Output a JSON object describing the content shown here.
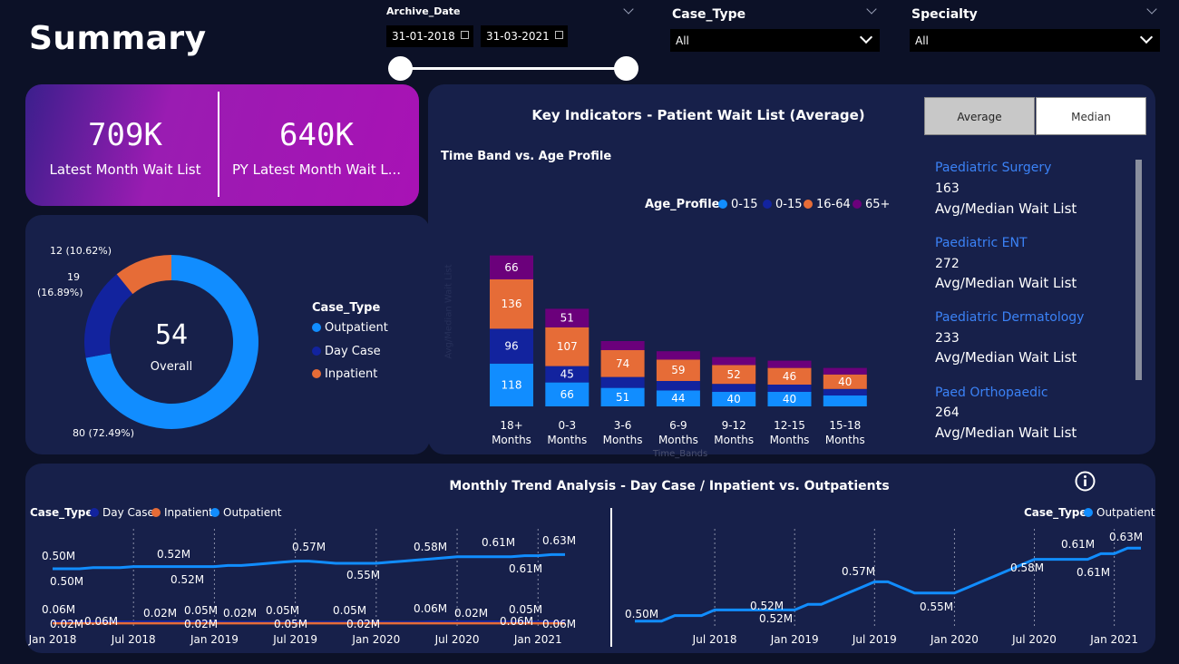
{
  "page_title": "Summary",
  "filters": {
    "archive_date": {
      "label": "Archive_Date",
      "start": "31-01-2018",
      "end": "31-03-2021"
    },
    "case_type": {
      "label": "Case_Type",
      "value": "All"
    },
    "specialty": {
      "label": "Specialty",
      "value": "All"
    }
  },
  "kpis": [
    {
      "value": "709K",
      "label": "Latest Month Wait List"
    },
    {
      "value": "640K",
      "label": "PY Latest Month Wait L..."
    }
  ],
  "donut": {
    "center_value": "54",
    "center_label": "Overall",
    "legend_title": "Case_Type",
    "legend": [
      {
        "name": "Outpatient",
        "color": "#118dff"
      },
      {
        "name": "Day Case",
        "color": "#12239e"
      },
      {
        "name": "Inpatient",
        "color": "#e66c37"
      }
    ],
    "labels": {
      "inpatient": "12 (10.62%)",
      "daycase_a": "19",
      "daycase_b": "(16.89%)",
      "outpatient": "80 (72.49%)"
    }
  },
  "key_indicators": {
    "title": "Key Indicators - Patient Wait List (Average)",
    "btn_average": "Average",
    "btn_median": "Median",
    "subtitle": "Time Band vs. Age Profile",
    "legend_title": "Age_Profile",
    "legend": [
      {
        "name": "0-15",
        "color": "#118dff"
      },
      {
        "name": "0-15",
        "color": "#12239e"
      },
      {
        "name": "16-64",
        "color": "#e66c37"
      },
      {
        "name": "65+",
        "color": "#6b007b"
      }
    ],
    "y_axis_label": "Avg/Median Wait List",
    "x_axis_label": "Time_Bands"
  },
  "chart_data": [
    {
      "type": "pie",
      "categories": [
        "Outpatient",
        "Day Case",
        "Inpatient"
      ],
      "values": [
        80,
        19,
        12
      ],
      "percent_labels": [
        "72.49%",
        "16.89%",
        "10.62%"
      ],
      "center": "54"
    },
    {
      "type": "bar",
      "stacked": true,
      "title": "Time Band vs. Age Profile",
      "xlabel": "Time_Bands",
      "ylabel": "Avg/Median Wait List",
      "categories": [
        "18+ Months",
        "0-3 Months",
        "3-6 Months",
        "6-9 Months",
        "9-12 Months",
        "12-15 Months",
        "15-18 Months"
      ],
      "series": [
        {
          "name": "0-15",
          "values": [
            118,
            66,
            51,
            44,
            40,
            40,
            30
          ]
        },
        {
          "name": "0-15",
          "values": [
            96,
            45,
            30,
            26,
            22,
            20,
            18
          ]
        },
        {
          "name": "16-64",
          "values": [
            136,
            107,
            74,
            59,
            52,
            46,
            40
          ]
        },
        {
          "name": "65+",
          "values": [
            66,
            51,
            25,
            23,
            22,
            20,
            18
          ]
        }
      ],
      "labelled": [
        [
          true,
          true,
          true,
          true,
          true,
          true,
          false
        ],
        [
          true,
          true,
          false,
          false,
          false,
          false,
          false
        ],
        [
          true,
          true,
          true,
          true,
          true,
          true,
          true
        ],
        [
          true,
          true,
          false,
          false,
          false,
          false,
          false
        ]
      ]
    },
    {
      "type": "line",
      "title": "Monthly Trend Analysis - Day Case / Inpatient vs. Outpatients",
      "x_ticks": [
        "Jan 2018",
        "Jul 2018",
        "Jan 2019",
        "Jul 2019",
        "Jan 2020",
        "Jul 2020",
        "Jan 2021"
      ],
      "series": [
        {
          "name": "Outpatient",
          "values": [
            0.5,
            0.5,
            0.5,
            0.51,
            0.51,
            0.51,
            0.52,
            0.52,
            0.52,
            0.52,
            0.52,
            0.52,
            0.52,
            0.53,
            0.53,
            0.54,
            0.55,
            0.56,
            0.57,
            0.57,
            0.56,
            0.55,
            0.55,
            0.55,
            0.55,
            0.56,
            0.57,
            0.58,
            0.59,
            0.6,
            0.61,
            0.61,
            0.61,
            0.61,
            0.61,
            0.62,
            0.62,
            0.63,
            0.63
          ]
        },
        {
          "name": "Day Case",
          "values": [
            0.06,
            0.06,
            0.06,
            0.06,
            0.06,
            0.06,
            0.06,
            0.06,
            0.06,
            0.06,
            0.06,
            0.06,
            0.06,
            0.05,
            0.05,
            0.05,
            0.05,
            0.05,
            0.05,
            0.05,
            0.05,
            0.05,
            0.05,
            0.05,
            0.05,
            0.05,
            0.05,
            0.05,
            0.06,
            0.06,
            0.06,
            0.06,
            0.06,
            0.06,
            0.06,
            0.06,
            0.06,
            0.06,
            0.06
          ]
        },
        {
          "name": "Inpatient",
          "values": [
            0.02,
            0.02,
            0.02,
            0.02,
            0.02,
            0.02,
            0.02,
            0.02,
            0.02,
            0.02,
            0.02,
            0.02,
            0.02,
            0.02,
            0.02,
            0.02,
            0.02,
            0.02,
            0.02,
            0.02,
            0.02,
            0.02,
            0.02,
            0.02,
            0.02,
            0.02,
            0.02,
            0.02,
            0.02,
            0.02,
            0.02,
            0.02,
            0.02,
            0.02,
            0.02,
            0.02,
            0.02,
            0.02,
            0.02
          ]
        }
      ]
    }
  ],
  "specialties": [
    {
      "name": "Paediatric Surgery",
      "value": "163",
      "sub": "Avg/Median Wait List"
    },
    {
      "name": "Paediatric ENT",
      "value": "272",
      "sub": "Avg/Median Wait List"
    },
    {
      "name": "Paediatric Dermatology",
      "value": "233",
      "sub": "Avg/Median Wait List"
    },
    {
      "name": "Paed Orthopaedic",
      "value": "264",
      "sub": "Avg/Median Wait List"
    }
  ],
  "trend": {
    "title": "Monthly Trend Analysis - Day Case / Inpatient vs. Outpatients",
    "legend_title": "Case_Type",
    "legend": [
      {
        "name": "Day Case",
        "color": "#12239e"
      },
      {
        "name": "Inpatient",
        "color": "#e66c37"
      },
      {
        "name": "Outpatient",
        "color": "#118dff"
      }
    ],
    "right_legend_title": "Case_Type",
    "right_legend_item": "Outpatient",
    "left_labels_top": [
      "0.50M",
      "0.52M",
      "0.57M",
      "0.58M",
      "0.61M",
      "0.63M"
    ],
    "left_labels_bottom": [
      "0.50M",
      "0.52M",
      "0.55M",
      "0.61M"
    ],
    "left_small_top": [
      "0.06M",
      "0.02M",
      "0.05M",
      "0.02M",
      "0.05M",
      "0.05M",
      "0.06M",
      "0.02M",
      "0.05M"
    ],
    "left_small_bottom": [
      "0.02M",
      "0.06M",
      "0.02M",
      "0.05M",
      "0.02M",
      "0.06M",
      "0.06M"
    ],
    "right_labels": [
      "0.50M",
      "0.52M",
      "0.52M",
      "0.57M",
      "0.55M",
      "0.58M",
      "0.61M",
      "0.61M",
      "0.63M"
    ],
    "x_ticks_left": [
      "Jan 2018",
      "Jul 2018",
      "Jan 2019",
      "Jul 2019",
      "Jan 2020",
      "Jul 2020",
      "Jan 2021"
    ],
    "x_ticks_right": [
      "Jul 2018",
      "Jan 2019",
      "Jul 2019",
      "Jan 2020",
      "Jul 2020",
      "Jan 2021"
    ],
    "info_icon": "info-icon"
  }
}
